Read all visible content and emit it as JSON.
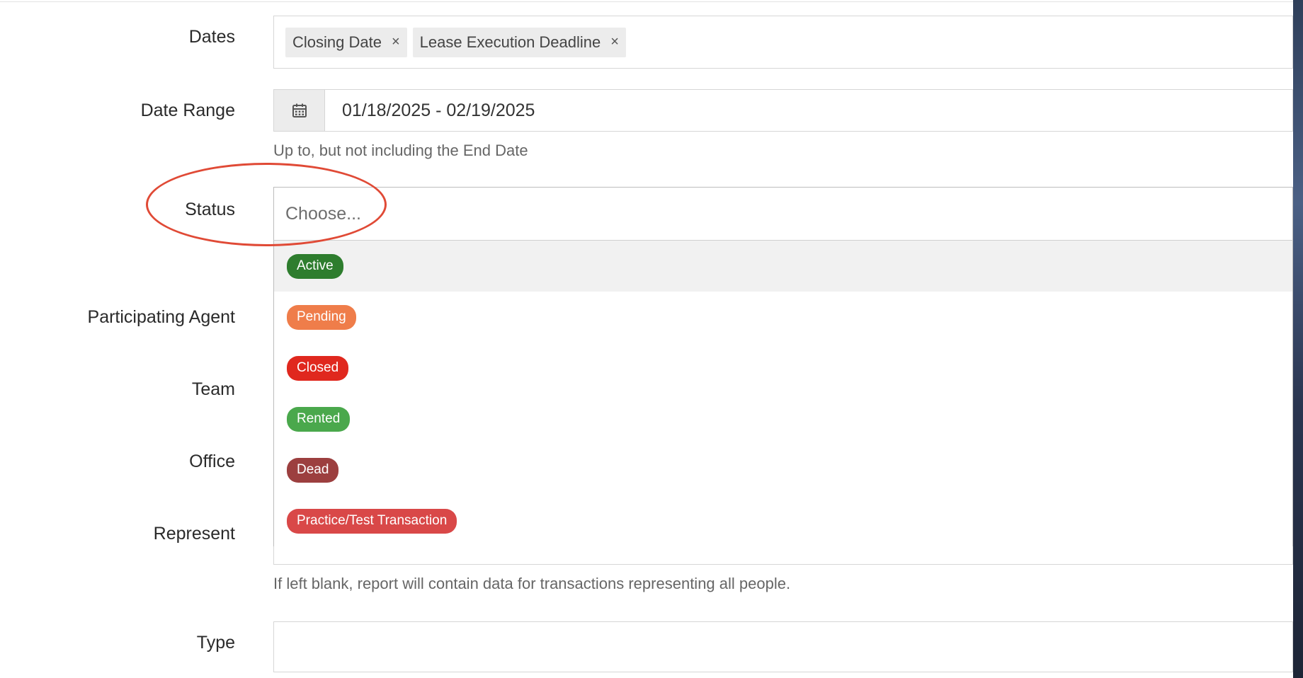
{
  "form": {
    "dates": {
      "label": "Dates",
      "tags": [
        "Closing Date",
        "Lease Execution Deadline"
      ],
      "remove_glyph": "×"
    },
    "date_range": {
      "label": "Date Range",
      "value": "01/18/2025 - 02/19/2025",
      "icon": "calendar-icon",
      "help": "Up to, but not including the End Date"
    },
    "status": {
      "label": "Status",
      "placeholder": "Choose...",
      "options": [
        {
          "label": "Active",
          "color": "#2e7d2e"
        },
        {
          "label": "Pending",
          "color": "#ef7d4a"
        },
        {
          "label": "Closed",
          "color": "#e0281e"
        },
        {
          "label": "Rented",
          "color": "#4aa84c"
        },
        {
          "label": "Dead",
          "color": "#9c3f3f"
        },
        {
          "label": "Practice/Test Transaction",
          "color": "#d94848"
        }
      ],
      "highlighted_option": "Active"
    },
    "participating_agent": {
      "label": "Participating Agent"
    },
    "team": {
      "label": "Team"
    },
    "office": {
      "label": "Office"
    },
    "represent": {
      "label": "Represent",
      "help": "If left blank, report will contain data for transactions representing all people."
    },
    "type": {
      "label": "Type"
    }
  },
  "annotation": {
    "color": "#e04a36"
  }
}
